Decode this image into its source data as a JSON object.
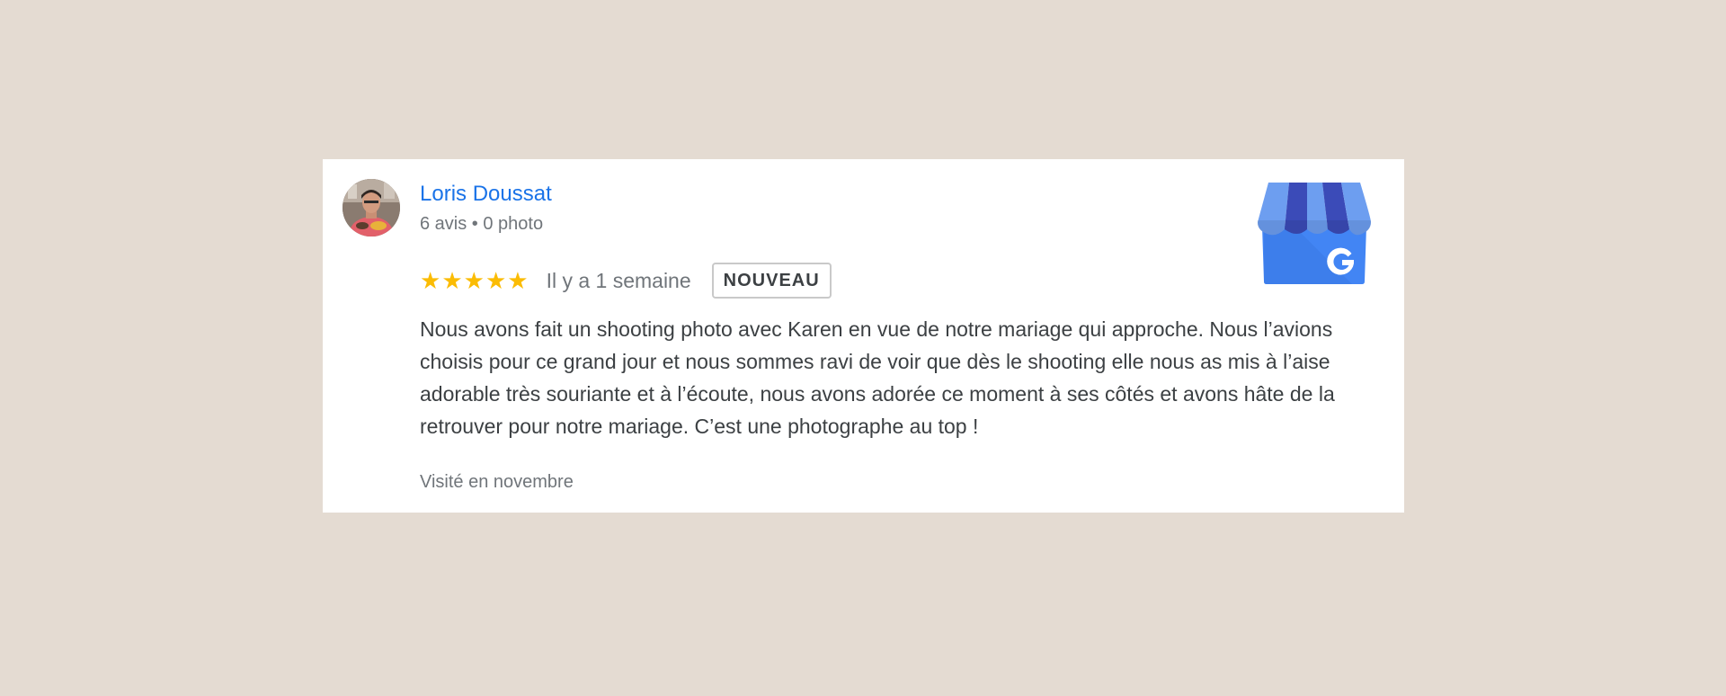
{
  "review": {
    "author": {
      "name": "Loris Doussat",
      "meta": "6 avis • 0 photo",
      "avatar_icon": "avatar-photo"
    },
    "rating": 5,
    "rating_max": 5,
    "stars": [
      "★",
      "★",
      "★",
      "★",
      "★"
    ],
    "time_ago": "Il y a 1 semaine",
    "badge": "NOUVEAU",
    "text": "Nous avons fait un shooting photo avec Karen en vue de notre mariage qui approche. Nous l’avions choisis pour ce grand jour et nous sommes ravi de voir que dès le shooting elle nous as mis à l’aise adorable très souriante et à l’écoute, nous avons adorée ce moment à ses côtés et avons hâte de la retrouver pour notre mariage. C’est une photographe au top !",
    "visited": "Visité en novembre",
    "source_icon": "google-my-business-icon"
  },
  "colors": {
    "background": "#e4dbd2",
    "card": "#ffffff",
    "author_link": "#1a73e8",
    "star": "#fbbc04",
    "secondary_text": "#70757a",
    "body_text": "#3c4043",
    "gmb_awning_light": "#6d9ef0",
    "gmb_awning_dark": "#3b4bb8",
    "gmb_store": "#4285f4"
  }
}
